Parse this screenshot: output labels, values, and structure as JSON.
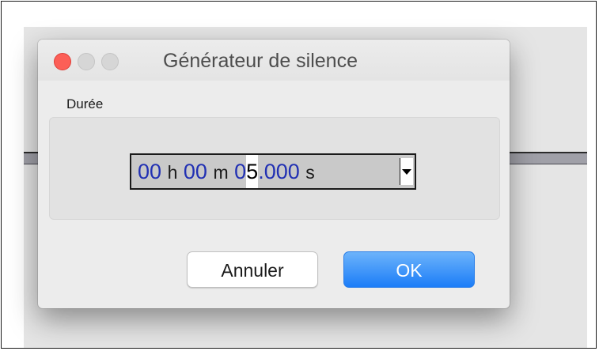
{
  "dialog": {
    "title": "Générateur de silence",
    "group_label": "Durée",
    "duration": {
      "hours": "00",
      "hours_unit": "h",
      "minutes": "00",
      "minutes_unit": "m",
      "seconds_lead": "0",
      "seconds_selected": "5",
      "seconds_rest": ".000",
      "seconds_unit": "s"
    },
    "cancel_label": "Annuler",
    "ok_label": "OK"
  },
  "colors": {
    "close_light": "#fc5f57",
    "ok_button": "#1c7df8",
    "digits": "#2130b3"
  }
}
